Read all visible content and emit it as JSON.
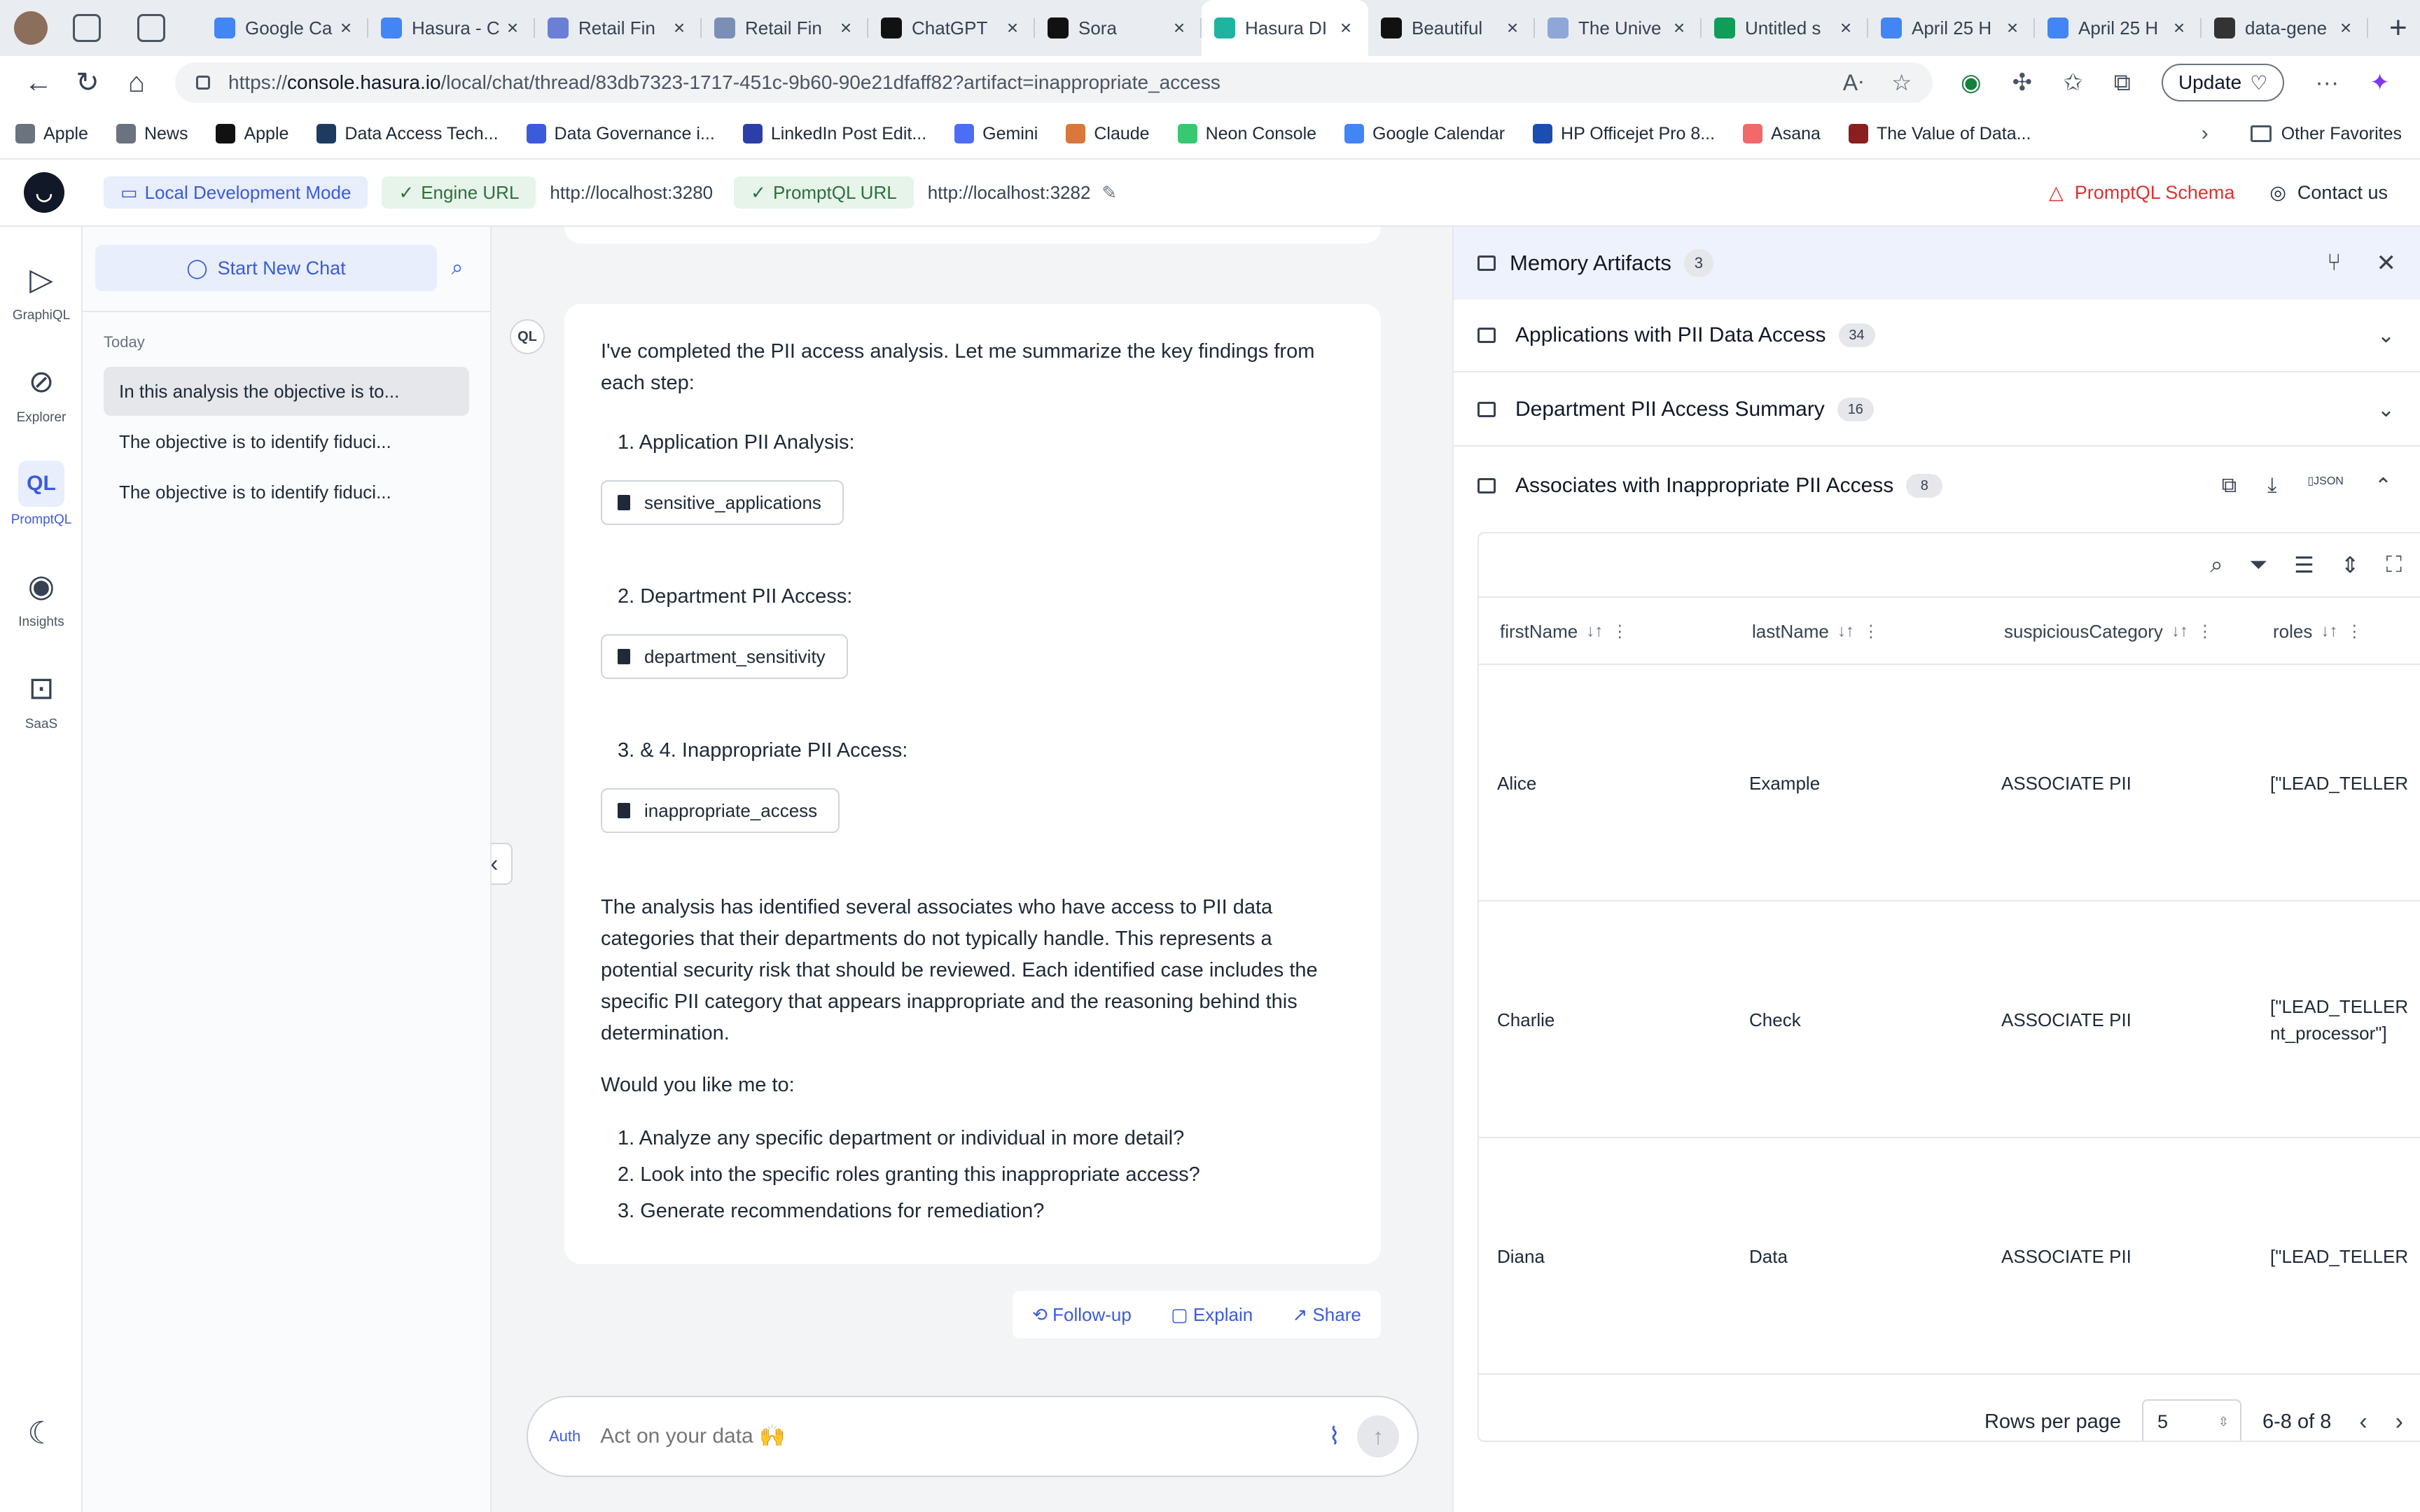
{
  "browser": {
    "tabs": [
      {
        "title": "Google Ca",
        "color": "#4285f4"
      },
      {
        "title": "Hasura - C",
        "color": "#4285f4"
      },
      {
        "title": "Retail Fin",
        "color": "#6b7fd7"
      },
      {
        "title": "Retail Fin",
        "color": "#7b8fb5"
      },
      {
        "title": "ChatGPT",
        "color": "#111111"
      },
      {
        "title": "Sora",
        "color": "#111111"
      },
      {
        "title": "Hasura DI",
        "color": "#1eb4a0",
        "active": true
      },
      {
        "title": "Beautiful",
        "color": "#111111"
      },
      {
        "title": "The Unive",
        "color": "#8ea6d8"
      },
      {
        "title": "Untitled s",
        "color": "#0f9d58"
      },
      {
        "title": "April 25 H",
        "color": "#4285f4"
      },
      {
        "title": "April 25 H",
        "color": "#4285f4"
      },
      {
        "title": "data-gene",
        "color": "#333333"
      }
    ],
    "url_prefix": "https://",
    "url_host": "console.hasura.io",
    "url_path": "/local/chat/thread/83db7323-1717-451c-9b60-90e21dfaff82?artifact=inappropriate_access",
    "update_label": "Update",
    "bookmarks": [
      {
        "label": "Apple",
        "color": "#6b7280"
      },
      {
        "label": "News",
        "color": "#6b7280"
      },
      {
        "label": "Apple",
        "color": "#111111"
      },
      {
        "label": "Data Access Tech...",
        "color": "#1e3a5f"
      },
      {
        "label": "Data Governance i...",
        "color": "#3b5bdb"
      },
      {
        "label": "LinkedIn Post Edit...",
        "color": "#2c3ea8"
      },
      {
        "label": "Gemini",
        "color": "#4c6ef5"
      },
      {
        "label": "Claude",
        "color": "#d9773c"
      },
      {
        "label": "Neon Console",
        "color": "#37c871"
      },
      {
        "label": "Google Calendar",
        "color": "#4285f4"
      },
      {
        "label": "HP Officejet Pro 8...",
        "color": "#1c4db0"
      },
      {
        "label": "Asana",
        "color": "#f06a6a"
      },
      {
        "label": "The Value of Data...",
        "color": "#8b1e1e"
      }
    ],
    "other_favorites": "Other Favorites"
  },
  "app_header": {
    "mode": "Local Development Mode",
    "engine_label": "Engine URL",
    "engine_url": "http://localhost:3280",
    "promptql_label": "PromptQL URL",
    "promptql_url": "http://localhost:3282",
    "schema_label": "PromptQL Schema",
    "contact_label": "Contact us"
  },
  "rail": [
    {
      "label": "GraphiQL",
      "icon": "play-icon"
    },
    {
      "label": "Explorer",
      "icon": "compass-icon"
    },
    {
      "label": "PromptQL",
      "icon": "promptql-icon",
      "active": true
    },
    {
      "label": "Insights",
      "icon": "eye-icon"
    },
    {
      "label": "SaaS",
      "icon": "lock-icon"
    }
  ],
  "sidebar": {
    "new_chat": "Start New Chat",
    "group": "Today",
    "items": [
      "In this analysis the objective is to...",
      "The objective is to identify fiduci...",
      "The objective is to identify fiduci..."
    ]
  },
  "message": {
    "avatar": "QL",
    "intro": "I've completed the PII access analysis. Let me summarize the key findings from each step:",
    "steps": [
      {
        "label": "1. Application PII Analysis:",
        "artifact": "sensitive_applications"
      },
      {
        "label": "2. Department PII Access:",
        "artifact": "department_sensitivity"
      },
      {
        "label": "3. & 4. Inappropriate PII Access:",
        "artifact": "inappropriate_access"
      }
    ],
    "summary": "The analysis has identified several associates who have access to PII data categories that their departments do not typically handle. This represents a potential security risk that should be reviewed. Each identified case includes the specific PII category that appears inappropriate and the reasoning behind this determination.",
    "question": "Would you like me to:",
    "options": [
      "1. Analyze any specific department or individual in more detail?",
      "2. Look into the specific roles granting this inappropriate access?",
      "3. Generate recommendations for remediation?"
    ]
  },
  "actions": {
    "followup": "Follow-up",
    "explain": "Explain",
    "share": "Share"
  },
  "composer": {
    "auth": "Auth",
    "placeholder": "Act on your data 🙌"
  },
  "panel": {
    "title": "Memory Artifacts",
    "count": "3",
    "sections": [
      {
        "title": "Applications with PII Data Access",
        "count": "34"
      },
      {
        "title": "Department PII Access Summary",
        "count": "16"
      },
      {
        "title": "Associates with Inappropriate PII Access",
        "count": "8"
      }
    ],
    "table": {
      "columns": [
        "firstName",
        "lastName",
        "suspiciousCategory",
        "roles"
      ],
      "rows": [
        [
          "Alice",
          "Example",
          "ASSOCIATE PII",
          "[\"LEAD_TELLER"
        ],
        [
          "Charlie",
          "Check",
          "ASSOCIATE PII",
          "[\"LEAD_TELLER\nnt_processor\"]"
        ],
        [
          "Diana",
          "Data",
          "ASSOCIATE PII",
          "[\"LEAD_TELLER"
        ]
      ],
      "rows_per_page_label": "Rows per page",
      "rows_per_page": "5",
      "range": "6-8 of 8"
    }
  }
}
